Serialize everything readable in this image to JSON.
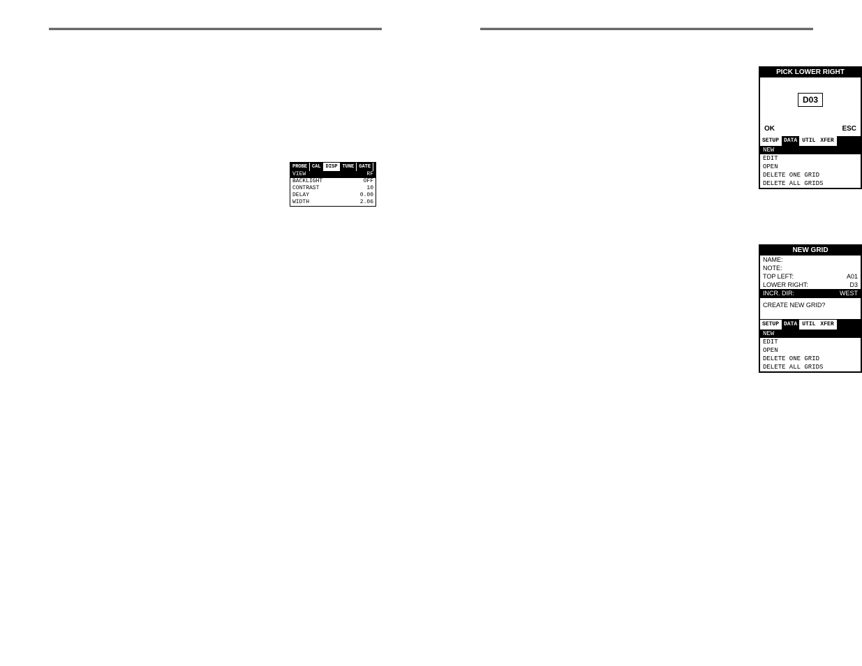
{
  "left_lcd": {
    "tabs": [
      "PROBE",
      "CAL",
      "DISP",
      "TUNE",
      "GATE"
    ],
    "tab_selected": 2,
    "rows": [
      {
        "label": "VIEW",
        "value": "RF",
        "selected": true
      },
      {
        "label": "BACKLIGHT",
        "value": "OFF",
        "selected": false
      },
      {
        "label": "CONTRAST",
        "value": "10",
        "selected": false
      },
      {
        "label": "DELAY",
        "value": "0.00",
        "selected": false
      },
      {
        "label": "WIDTH",
        "value": "2.06",
        "selected": false
      }
    ]
  },
  "lcd1": {
    "title": "PICK LOWER RIGHT",
    "value": "D03",
    "ok": "OK",
    "esc": "ESC",
    "tabs": [
      "SETUP",
      "DATA",
      "UTIL",
      "XFER"
    ],
    "tab_selected": 1,
    "menu": [
      {
        "label": "NEW",
        "selected": true
      },
      {
        "label": "EDIT",
        "selected": false
      },
      {
        "label": "OPEN",
        "selected": false
      },
      {
        "label": "DELETE ONE GRID",
        "selected": false
      },
      {
        "label": "DELETE ALL GRIDS",
        "selected": false
      }
    ]
  },
  "lcd2": {
    "title": "NEW GRID",
    "params": [
      {
        "label": "NAME:",
        "value": "",
        "selected": false
      },
      {
        "label": "NOTE:",
        "value": "",
        "selected": false
      },
      {
        "label": "TOP LEFT:",
        "value": "A01",
        "selected": false
      },
      {
        "label": "LOWER RIGHT:",
        "value": "D3",
        "selected": false
      },
      {
        "label": "INCR. DIR:",
        "value": "WEST",
        "selected": true
      }
    ],
    "prompt": "CREATE NEW GRID?",
    "tabs": [
      "SETUP",
      "DATA",
      "UTIL",
      "XFER"
    ],
    "tab_selected": 1,
    "menu": [
      {
        "label": "NEW",
        "selected": true
      },
      {
        "label": "EDIT",
        "selected": false
      },
      {
        "label": "OPEN",
        "selected": false
      },
      {
        "label": "DELETE ONE GRID",
        "selected": false
      },
      {
        "label": "DELETE ALL GRIDS",
        "selected": false
      }
    ]
  }
}
